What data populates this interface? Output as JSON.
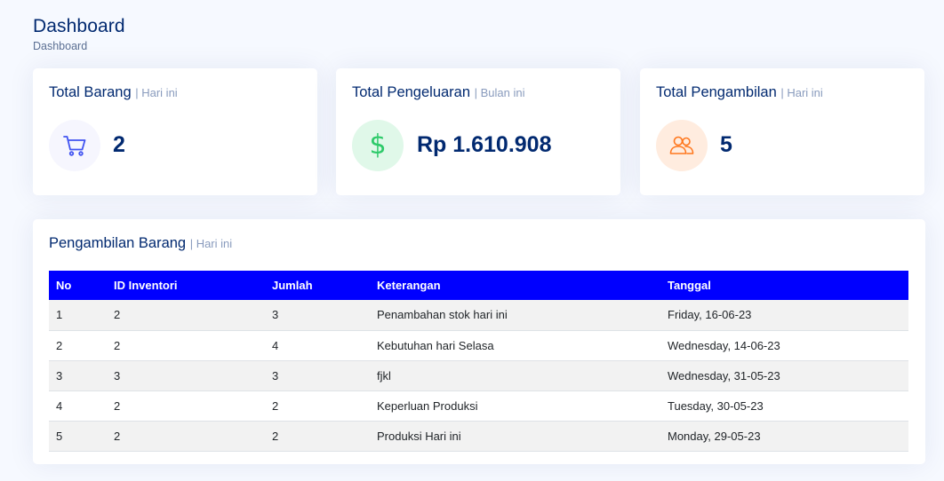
{
  "header": {
    "title": "Dashboard",
    "breadcrumb": "Dashboard"
  },
  "cards": [
    {
      "title": "Total Barang",
      "sub": "| Hari ini",
      "value": "2",
      "icon": "cart-icon",
      "icon_bg": "#f6f6fe",
      "icon_color": "#4154f1"
    },
    {
      "title": "Total Pengeluaran",
      "sub": "| Bulan ini",
      "value": "Rp 1.610.908",
      "icon": "dollar-icon",
      "icon_bg": "#e0f8e9",
      "icon_color": "#2eca6a"
    },
    {
      "title": "Total Pengambilan",
      "sub": "| Hari ini",
      "value": "5",
      "icon": "people-icon",
      "icon_bg": "#ffecdf",
      "icon_color": "#ff771d"
    }
  ],
  "table": {
    "title": "Pengambilan Barang",
    "sub": "| Hari ini",
    "header_color": "#0000ff",
    "columns": [
      "No",
      "ID Inventori",
      "Jumlah",
      "Keterangan",
      "Tanggal"
    ],
    "rows": [
      [
        "1",
        "2",
        "3",
        "Penambahan stok hari ini",
        "Friday, 16-06-23"
      ],
      [
        "2",
        "2",
        "4",
        "Kebutuhan hari Selasa",
        "Wednesday, 14-06-23"
      ],
      [
        "3",
        "3",
        "3",
        "fjkl",
        "Wednesday, 31-05-23"
      ],
      [
        "4",
        "2",
        "2",
        "Keperluan Produksi",
        "Tuesday, 30-05-23"
      ],
      [
        "5",
        "2",
        "2",
        "Produksi Hari ini",
        "Monday, 29-05-23"
      ]
    ]
  }
}
